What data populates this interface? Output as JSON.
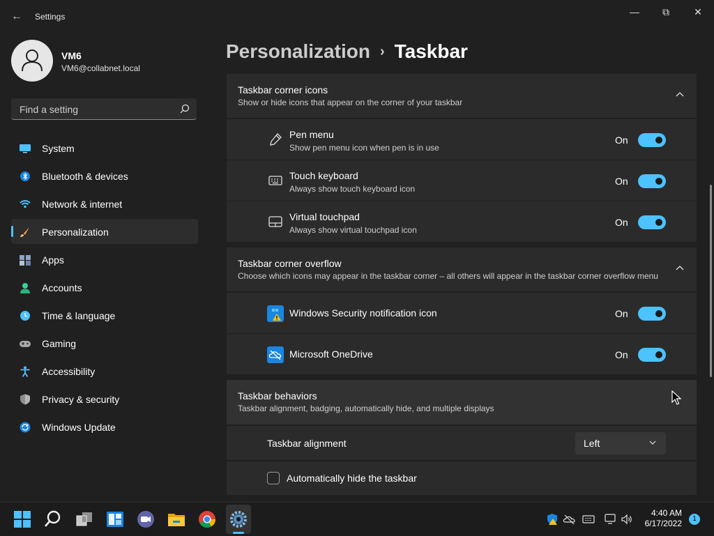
{
  "window": {
    "title": "Settings",
    "back_glyph": "←",
    "minimize_glyph": "—",
    "restore_glyph": "⧉",
    "close_glyph": "✕"
  },
  "user": {
    "name": "VM6",
    "email": "VM6@collabnet.local"
  },
  "search": {
    "placeholder": "Find a setting"
  },
  "nav": [
    {
      "label": "System",
      "icon": "monitor-icon"
    },
    {
      "label": "Bluetooth & devices",
      "icon": "bluetooth-icon"
    },
    {
      "label": "Network & internet",
      "icon": "wifi-icon"
    },
    {
      "label": "Personalization",
      "icon": "brush-icon",
      "active": true
    },
    {
      "label": "Apps",
      "icon": "apps-icon"
    },
    {
      "label": "Accounts",
      "icon": "person-icon"
    },
    {
      "label": "Time & language",
      "icon": "clock-globe-icon"
    },
    {
      "label": "Gaming",
      "icon": "gamepad-icon"
    },
    {
      "label": "Accessibility",
      "icon": "accessibility-icon"
    },
    {
      "label": "Privacy & security",
      "icon": "shield-icon"
    },
    {
      "label": "Windows Update",
      "icon": "update-icon"
    }
  ],
  "breadcrumb": {
    "parent": "Personalization",
    "separator": "›",
    "current": "Taskbar"
  },
  "corner_icons": {
    "title": "Taskbar corner icons",
    "desc": "Show or hide icons that appear on the corner of your taskbar",
    "items": [
      {
        "title": "Pen menu",
        "sub": "Show pen menu icon when pen is in use",
        "state": "On"
      },
      {
        "title": "Touch keyboard",
        "sub": "Always show touch keyboard icon",
        "state": "On"
      },
      {
        "title": "Virtual touchpad",
        "sub": "Always show virtual touchpad icon",
        "state": "On"
      }
    ]
  },
  "corner_overflow": {
    "title": "Taskbar corner overflow",
    "desc": "Choose which icons may appear in the taskbar corner – all others will appear in the taskbar corner overflow menu",
    "items": [
      {
        "title": "Windows Security notification icon",
        "state": "On"
      },
      {
        "title": "Microsoft OneDrive",
        "state": "On"
      }
    ]
  },
  "behaviors": {
    "title": "Taskbar behaviors",
    "desc": "Taskbar alignment, badging, automatically hide, and multiple displays",
    "alignment_label": "Taskbar alignment",
    "alignment_value": "Left",
    "autohide_label": "Automatically hide the taskbar"
  },
  "taskbar": {
    "apps": [
      "start-icon",
      "search-icon",
      "task-view-icon",
      "widgets-icon",
      "teams-chat-icon",
      "file-explorer-icon",
      "chrome-icon",
      "settings-gear-icon"
    ],
    "time": "4:40 AM",
    "date": "6/17/2022",
    "notification_count": "1"
  },
  "colors": {
    "accent": "#4cc2ff",
    "background": "#202020",
    "card": "#2b2b2b"
  }
}
